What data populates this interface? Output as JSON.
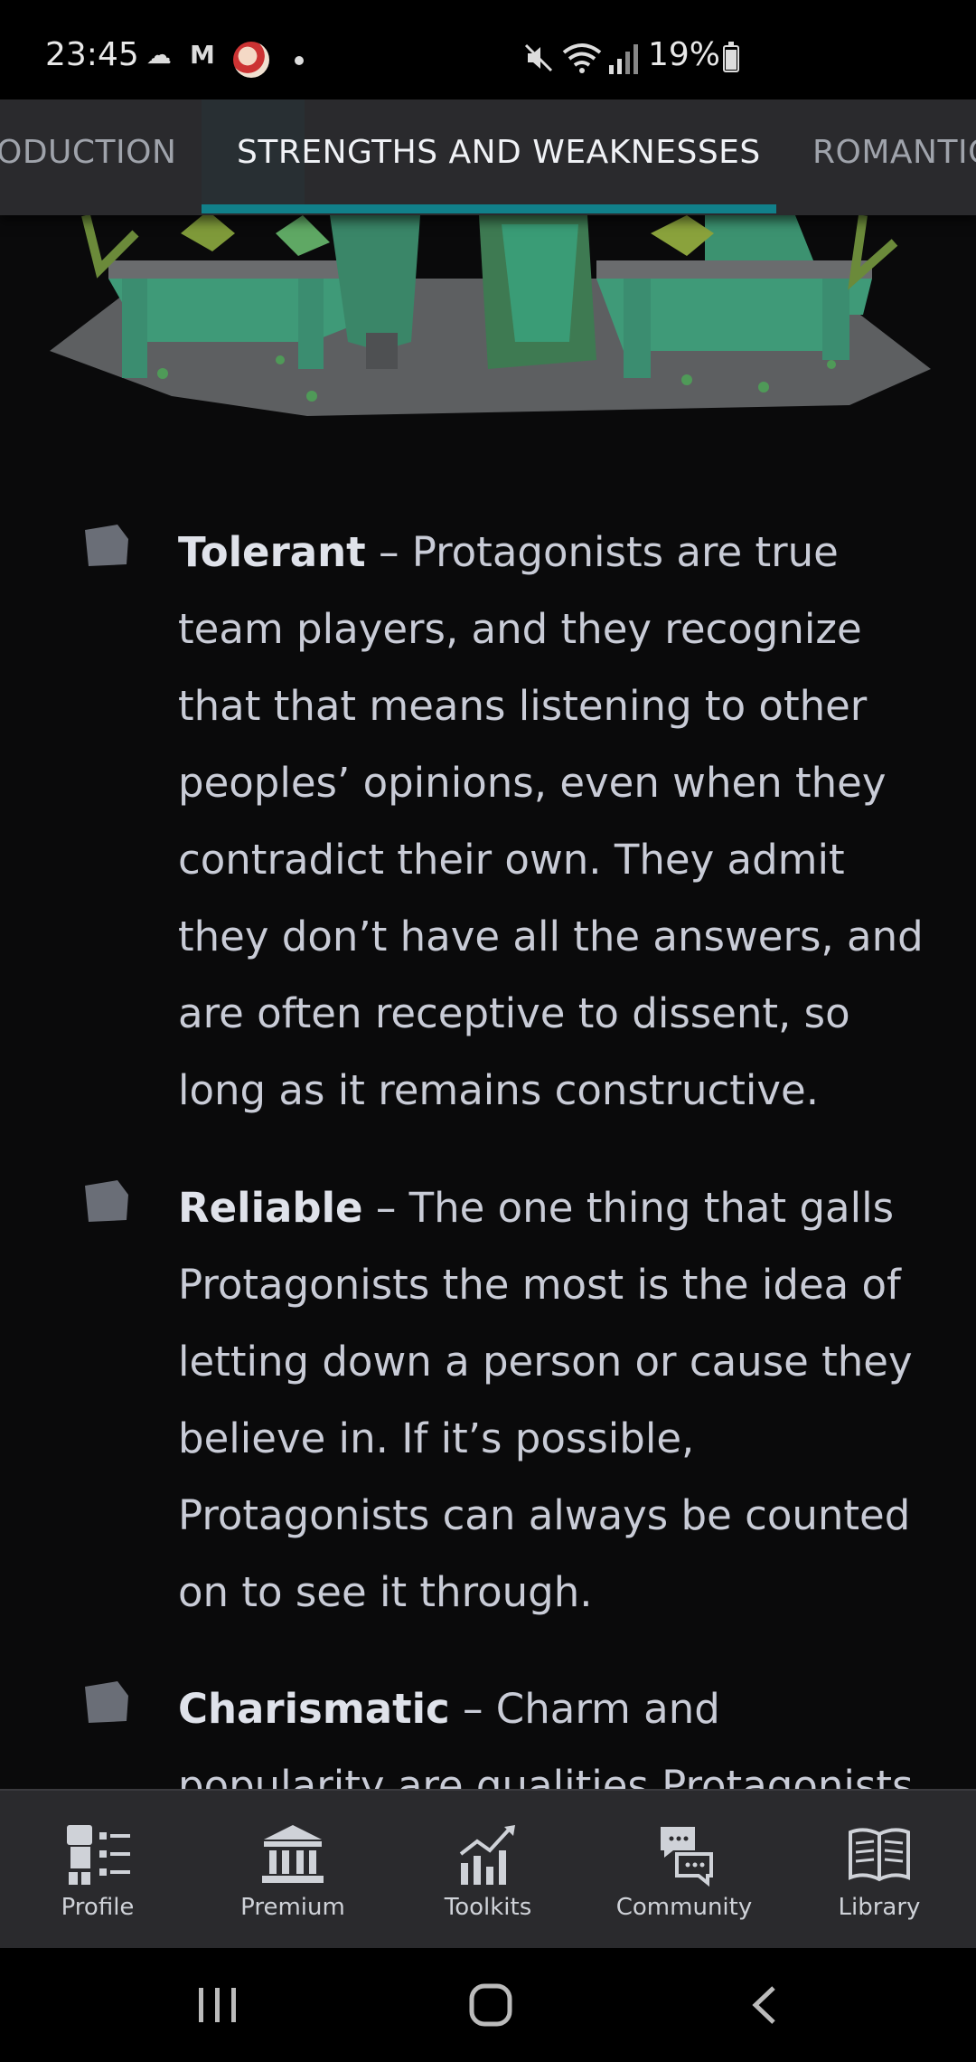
{
  "status_bar": {
    "time": "23:45",
    "battery_percent": "19%",
    "icons": [
      "cloud-icon",
      "mail-icon",
      "avatar",
      "dot",
      "mute-icon",
      "wifi-icon",
      "signal-icon",
      "battery-icon"
    ]
  },
  "tabs": [
    {
      "label": "ODUCTION",
      "active": false
    },
    {
      "label": "STRENGTHS AND WEAKNESSES",
      "active": true
    },
    {
      "label": "ROMANTIC",
      "active": false
    }
  ],
  "accent_color": "#11808a",
  "items": [
    {
      "title": "Tolerant",
      "text": " – Protagonists are true team players, and they recognize that that means listening to other peoples’ opinions, even when they contradict their own. They admit they don’t have all the answers, and are often receptive to dissent, so long as it remains constructive."
    },
    {
      "title": "Reliable",
      "text": " – The one thing that galls Protagonists the most is the idea of letting down a person or cause they believe in. If it’s possible, Protagonists can always be counted on to see it through."
    },
    {
      "title": "Charismatic",
      "text": " – Charm and popularity are qualities Protagonists have in"
    }
  ],
  "bottom_nav": [
    {
      "label": "Profile",
      "icon": "profile-icon"
    },
    {
      "label": "Premium",
      "icon": "premium-icon"
    },
    {
      "label": "Toolkits",
      "icon": "toolkits-icon"
    },
    {
      "label": "Community",
      "icon": "community-icon"
    },
    {
      "label": "Library",
      "icon": "library-icon"
    }
  ],
  "system_nav": [
    "recents-icon",
    "home-icon",
    "back-icon"
  ]
}
